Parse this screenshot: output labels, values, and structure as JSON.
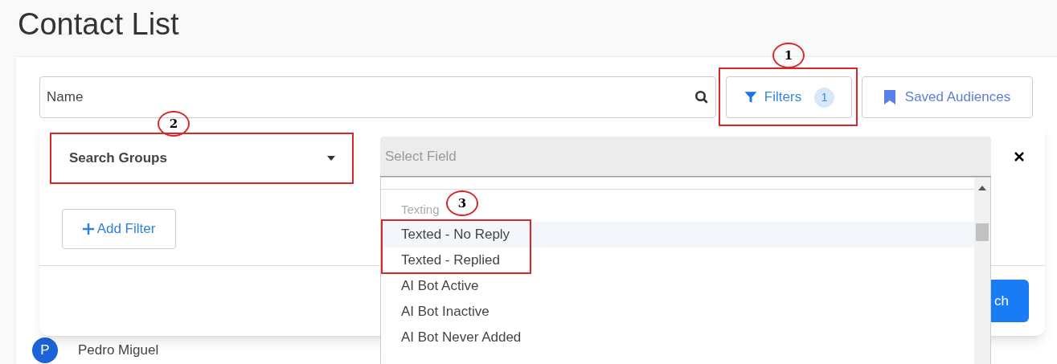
{
  "page_title": "Contact List",
  "search": {
    "placeholder": "Name"
  },
  "filters_button": {
    "label": "Filters",
    "count": "1"
  },
  "saved_audiences_button": {
    "label": "Saved Audiences"
  },
  "filter_panel": {
    "group_select": {
      "value": "Search Groups"
    },
    "field_select": {
      "placeholder": "Select Field"
    },
    "add_filter_button": {
      "label": "Add Filter"
    },
    "search_button": {
      "label": "ch"
    },
    "dropdown": {
      "group_label": "Texting",
      "options": [
        {
          "label": "Texted - No Reply",
          "selected": true
        },
        {
          "label": "Texted - Replied",
          "selected": false
        },
        {
          "label": "AI Bot Active",
          "selected": false
        },
        {
          "label": "AI Bot Inactive",
          "selected": false
        },
        {
          "label": "AI Bot Never Added",
          "selected": false
        }
      ]
    }
  },
  "contact_row": {
    "initial": "P",
    "name": "Pedro Miguel"
  },
  "annotations": [
    {
      "number": "1"
    },
    {
      "number": "2"
    },
    {
      "number": "3"
    }
  ]
}
